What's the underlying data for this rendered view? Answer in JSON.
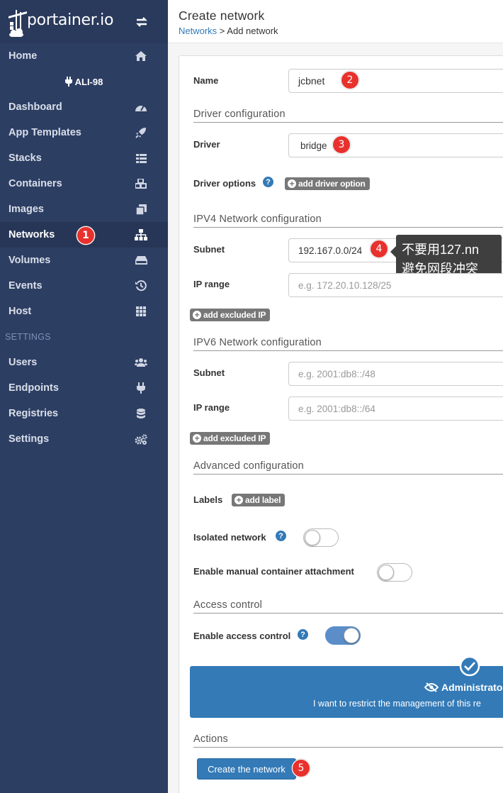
{
  "app": {
    "brand": "portainer.io"
  },
  "sidebar": {
    "home": "Home",
    "endpoint": "ALI-98",
    "items": [
      {
        "label": "Dashboard"
      },
      {
        "label": "App Templates"
      },
      {
        "label": "Stacks"
      },
      {
        "label": "Containers"
      },
      {
        "label": "Images"
      },
      {
        "label": "Networks"
      },
      {
        "label": "Volumes"
      },
      {
        "label": "Events"
      },
      {
        "label": "Host"
      }
    ],
    "settings_title": "SETTINGS",
    "settings_items": [
      {
        "label": "Users"
      },
      {
        "label": "Endpoints"
      },
      {
        "label": "Registries"
      },
      {
        "label": "Settings"
      }
    ]
  },
  "header": {
    "title": "Create network",
    "breadcrumb_link": "Networks",
    "breadcrumb_sep": " > ",
    "breadcrumb_current": "Add network"
  },
  "form": {
    "name_label": "Name",
    "name_value": "jcbnet",
    "driver_section": "Driver configuration",
    "driver_label": "Driver",
    "driver_value": "bridge",
    "driver_options_label": "Driver options",
    "add_driver_option": "add driver option",
    "ipv4_section": "IPV4 Network configuration",
    "ipv4_subnet_label": "Subnet",
    "ipv4_subnet_value": "192.167.0.0/24",
    "ipv4_range_label": "IP range",
    "ipv4_range_placeholder": "e.g. 172.20.10.128/25",
    "add_excluded_ip": "add excluded IP",
    "ipv6_section": "IPV6 Network configuration",
    "ipv6_subnet_label": "Subnet",
    "ipv6_subnet_placeholder": "e.g. 2001:db8::/48",
    "ipv6_range_label": "IP range",
    "ipv6_range_placeholder": "e.g. 2001:db8::/64",
    "add_excluded_ip_v6": "add excluded IP",
    "advanced_section": "Advanced configuration",
    "labels_label": "Labels",
    "add_label": "add label",
    "isolated_label": "Isolated network",
    "isolated_on": false,
    "manual_attach_label": "Enable manual container attachment",
    "manual_attach_on": false,
    "access_section": "Access control",
    "access_label": "Enable access control",
    "access_on": true,
    "access_box_title": "Administrato",
    "access_box_desc": "I want to restrict the management of this re",
    "actions_section": "Actions",
    "create_button": "Create the network"
  },
  "annotations": {
    "tooltip_line1": "不要用127.nn",
    "tooltip_line2": "避免网段冲突",
    "badges": [
      "1",
      "2",
      "3",
      "4",
      "5"
    ]
  },
  "colors": {
    "sidebar_bg": "#2d3e63",
    "primary": "#337ab7",
    "badge_red": "#e8312d"
  }
}
